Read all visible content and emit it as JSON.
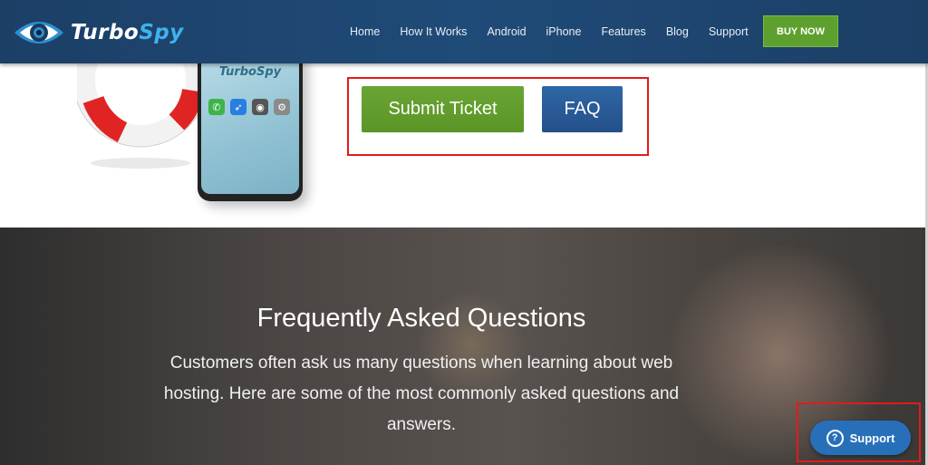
{
  "header": {
    "logo_text_1": "Turbo",
    "logo_text_2": "Spy",
    "nav": [
      "Home",
      "How It Works",
      "Android",
      "iPhone",
      "Features",
      "Blog",
      "Support"
    ],
    "buy_label": "BUY NOW"
  },
  "hero": {
    "phone_brand": "TurboSpy",
    "submit_label": "Submit Ticket",
    "faq_label": "FAQ"
  },
  "faq": {
    "title": "Frequently Asked Questions",
    "description": "Customers often ask us many questions when learning about web hosting. Here are some of the most commonly asked questions and answers."
  },
  "support_widget": {
    "label": "Support"
  },
  "colors": {
    "header": "#1f4b78",
    "buy": "#5ea02e",
    "submit": "#5a9526",
    "faq_button": "#24508a",
    "highlight": "#e21b1b",
    "support": "#2770b9"
  },
  "icons": [
    "eye-logo-icon",
    "phone-icon",
    "compass-icon",
    "camera-icon",
    "settings-icon",
    "question-icon"
  ]
}
